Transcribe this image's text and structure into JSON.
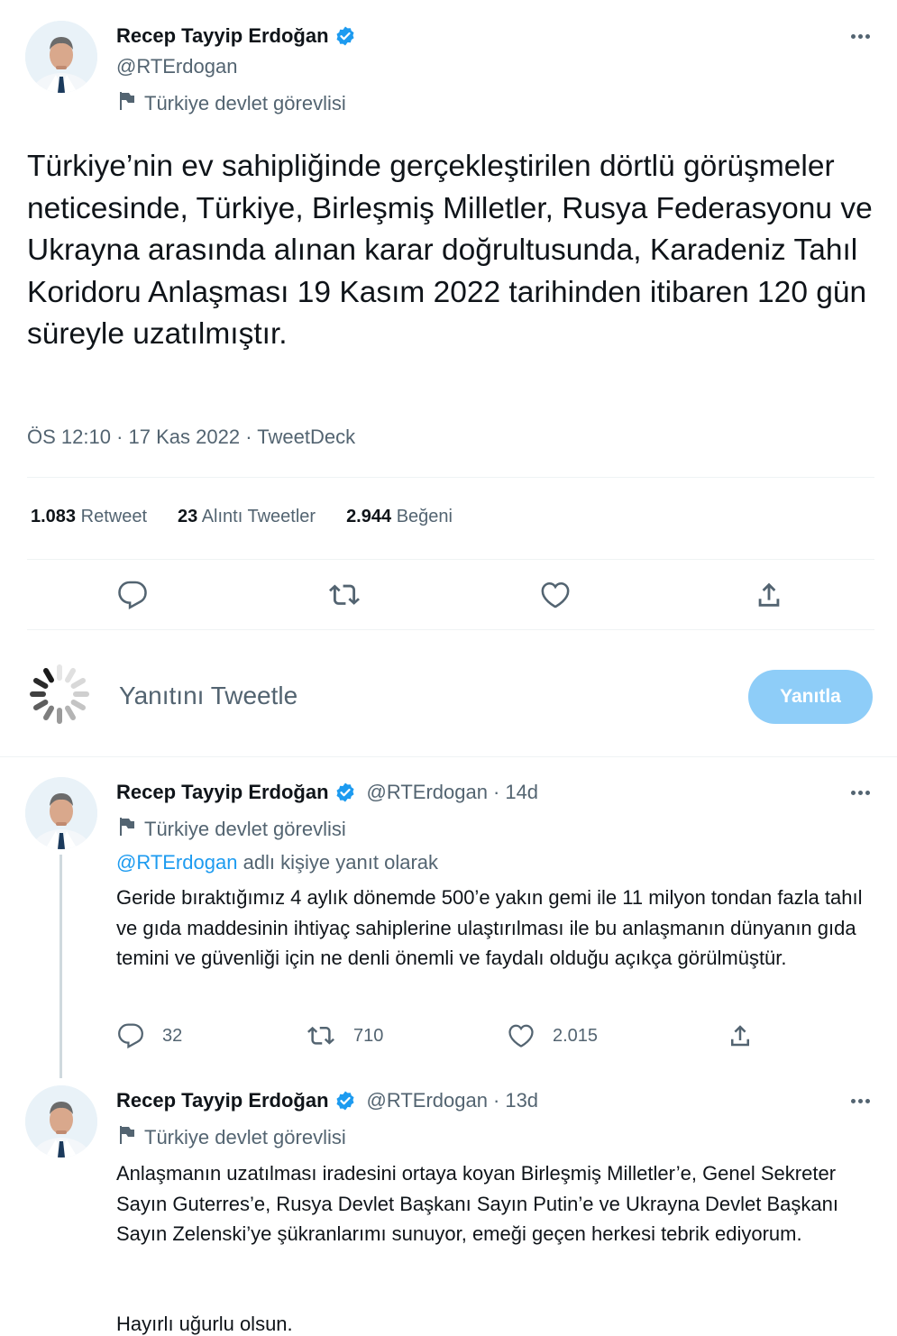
{
  "main_tweet": {
    "author_name": "Recep Tayyip Erdoğan",
    "handle": "@RTErdogan",
    "label": "Türkiye devlet görevlisi",
    "text": "Türkiye’nin ev sahipliğinde gerçekleştirilen dörtlü görüşmeler neticesinde, Türkiye, Birleşmiş Milletler, Rusya Federasyonu ve Ukrayna arasında alınan karar doğrultusunda, Karadeniz Tahıl Koridoru Anlaşması 19 Kasım 2022 tarihinden itibaren 120 gün süreyle uzatılmıştır.",
    "time": "ÖS 12:10",
    "date": "17 Kas 2022",
    "source": "TweetDeck",
    "separator": "·",
    "stats": {
      "retweets_count": "1.083",
      "retweets_label": "Retweet",
      "quotes_count": "23",
      "quotes_label": "Alıntı Tweetler",
      "likes_count": "2.944",
      "likes_label": "Beğeni"
    }
  },
  "composer": {
    "placeholder": "Yanıtını Tweetle",
    "button": "Yanıtla"
  },
  "replies": [
    {
      "author_name": "Recep Tayyip Erdoğan",
      "handle": "@RTErdogan",
      "separator": "·",
      "time_ago": "14d",
      "label": "Türkiye devlet görevlisi",
      "reply_to_mention": "@RTErdogan",
      "reply_to_suffix": "adlı kişiye yanıt olarak",
      "text": "Geride bıraktığımız 4 aylık dönemde 500’e yakın gemi ile 11 milyon tondan fazla tahıl ve gıda maddesinin ihtiyaç sahiplerine ulaştırılması ile bu anlaşmanın dünyanın gıda temini ve güvenliği için ne denli önemli ve faydalı olduğu açıkça görülmüştür.",
      "reply_count": "32",
      "retweet_count": "710",
      "like_count": "2.015"
    },
    {
      "author_name": "Recep Tayyip Erdoğan",
      "handle": "@RTErdogan",
      "separator": "·",
      "time_ago": "13d",
      "label": "Türkiye devlet görevlisi",
      "text": "Anlaşmanın uzatılması iradesini ortaya koyan Birleşmiş Milletler’e, Genel Sekreter Sayın Guterres’e, Rusya Devlet Başkanı Sayın Putin’e ve Ukrayna Devlet Başkanı Sayın Zelenski’ye şükranlarımı sunuyor, emeği geçen herkesi tebrik ediyorum.",
      "text2": "Hayırlı uğurlu olsun."
    }
  ],
  "colors": {
    "verified": "#1d9bf0",
    "link": "#1d9bf0",
    "secondary_text": "#536471",
    "reply_button": "#8ecdf8"
  }
}
